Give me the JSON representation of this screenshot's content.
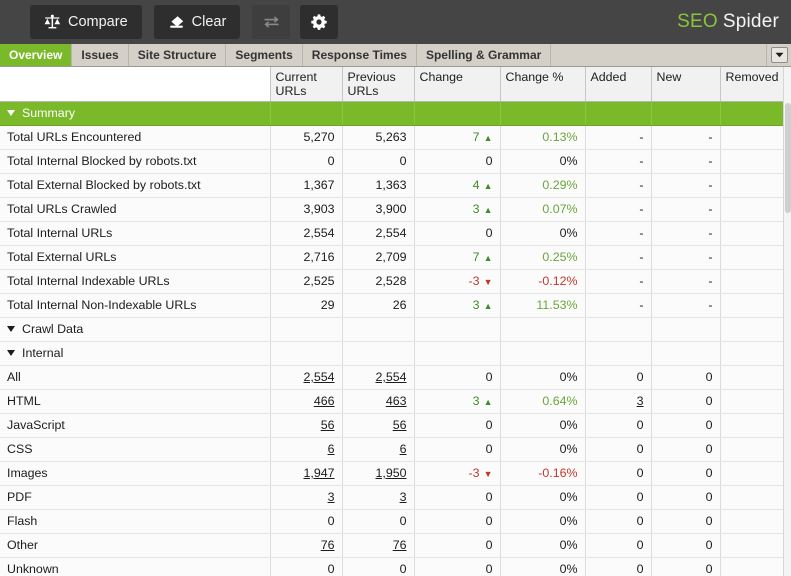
{
  "toolbar": {
    "compare_label": "Compare",
    "clear_label": "Clear",
    "swap_label": "",
    "settings_label": "",
    "logo_primary": "SEO",
    "logo_secondary": "Spider",
    "accent_color": "#7ab929",
    "bar_color": "#454545"
  },
  "tabs": [
    {
      "label": "Overview",
      "active": true
    },
    {
      "label": "Issues",
      "active": false
    },
    {
      "label": "Site Structure",
      "active": false
    },
    {
      "label": "Segments",
      "active": false
    },
    {
      "label": "Response Times",
      "active": false
    },
    {
      "label": "Spelling & Grammar",
      "active": false
    }
  ],
  "table": {
    "columns": [
      "",
      "Current URLs",
      "Previous URLs",
      "Change",
      "Change %",
      "Added",
      "New",
      "Removed"
    ],
    "rows": [
      {
        "type": "group",
        "indent": 0,
        "expanded": true,
        "name": "Summary",
        "current": "",
        "previous": "",
        "change": "",
        "change_pct": "",
        "added": "",
        "new": "",
        "removed": ""
      },
      {
        "type": "data",
        "indent": 1,
        "name": "Total URLs Encountered",
        "current": "5,270",
        "previous": "5,263",
        "change": "7",
        "change_dir": "up",
        "change_pct": "0.13%",
        "pct_dir": "pos",
        "added": "-",
        "new": "-",
        "removed": ""
      },
      {
        "type": "data",
        "indent": 1,
        "name": "Total Internal Blocked by robots.txt",
        "current": "0",
        "previous": "0",
        "change": "0",
        "change_dir": "none",
        "change_pct": "0%",
        "pct_dir": "none",
        "added": "-",
        "new": "-",
        "removed": ""
      },
      {
        "type": "data",
        "indent": 1,
        "name": "Total External Blocked by robots.txt",
        "current": "1,367",
        "previous": "1,363",
        "change": "4",
        "change_dir": "up",
        "change_pct": "0.29%",
        "pct_dir": "pos",
        "added": "-",
        "new": "-",
        "removed": ""
      },
      {
        "type": "data",
        "indent": 1,
        "name": "Total URLs Crawled",
        "current": "3,903",
        "previous": "3,900",
        "change": "3",
        "change_dir": "up",
        "change_pct": "0.07%",
        "pct_dir": "pos",
        "added": "-",
        "new": "-",
        "removed": ""
      },
      {
        "type": "data",
        "indent": 1,
        "name": "Total Internal URLs",
        "current": "2,554",
        "previous": "2,554",
        "change": "0",
        "change_dir": "none",
        "change_pct": "0%",
        "pct_dir": "none",
        "added": "-",
        "new": "-",
        "removed": ""
      },
      {
        "type": "data",
        "indent": 1,
        "name": "Total External URLs",
        "current": "2,716",
        "previous": "2,709",
        "change": "7",
        "change_dir": "up",
        "change_pct": "0.25%",
        "pct_dir": "pos",
        "added": "-",
        "new": "-",
        "removed": ""
      },
      {
        "type": "data",
        "indent": 1,
        "name": "Total Internal Indexable URLs",
        "current": "2,525",
        "previous": "2,528",
        "change": "-3",
        "change_dir": "down",
        "change_pct": "-0.12%",
        "pct_dir": "neg",
        "added": "-",
        "new": "-",
        "removed": ""
      },
      {
        "type": "data",
        "indent": 1,
        "name": "Total Internal Non-Indexable URLs",
        "current": "29",
        "previous": "26",
        "change": "3",
        "change_dir": "up",
        "change_pct": "11.53%",
        "pct_dir": "pos",
        "added": "-",
        "new": "-",
        "removed": ""
      },
      {
        "type": "section",
        "indent": 0,
        "expanded": true,
        "name": "Crawl Data",
        "current": "",
        "previous": "",
        "change": "",
        "change_pct": "",
        "added": "",
        "new": "",
        "removed": ""
      },
      {
        "type": "section",
        "indent": 1,
        "expanded": true,
        "name": "Internal",
        "current": "",
        "previous": "",
        "change": "",
        "change_pct": "",
        "added": "",
        "new": "",
        "removed": ""
      },
      {
        "type": "data",
        "indent": 2,
        "name": "All",
        "linked": true,
        "current": "2,554",
        "previous": "2,554",
        "change": "0",
        "change_dir": "none",
        "change_pct": "0%",
        "pct_dir": "none",
        "added": "0",
        "new": "0",
        "removed": ""
      },
      {
        "type": "data",
        "indent": 2,
        "name": "HTML",
        "linked": true,
        "current": "466",
        "previous": "463",
        "change": "3",
        "change_dir": "up",
        "change_pct": "0.64%",
        "pct_dir": "pos",
        "added": "3",
        "added_linked": true,
        "new": "0",
        "removed": ""
      },
      {
        "type": "data",
        "indent": 2,
        "name": "JavaScript",
        "linked": true,
        "current": "56",
        "previous": "56",
        "change": "0",
        "change_dir": "none",
        "change_pct": "0%",
        "pct_dir": "none",
        "added": "0",
        "new": "0",
        "removed": ""
      },
      {
        "type": "data",
        "indent": 2,
        "name": "CSS",
        "linked": true,
        "current": "6",
        "previous": "6",
        "change": "0",
        "change_dir": "none",
        "change_pct": "0%",
        "pct_dir": "none",
        "added": "0",
        "new": "0",
        "removed": ""
      },
      {
        "type": "data",
        "indent": 2,
        "name": "Images",
        "linked": true,
        "current": "1,947",
        "previous": "1,950",
        "change": "-3",
        "change_dir": "down",
        "change_pct": "-0.16%",
        "pct_dir": "neg",
        "added": "0",
        "new": "0",
        "removed": ""
      },
      {
        "type": "data",
        "indent": 2,
        "name": "PDF",
        "linked": true,
        "current": "3",
        "previous": "3",
        "change": "0",
        "change_dir": "none",
        "change_pct": "0%",
        "pct_dir": "none",
        "added": "0",
        "new": "0",
        "removed": ""
      },
      {
        "type": "data",
        "indent": 2,
        "name": "Flash",
        "linked": false,
        "current": "0",
        "previous": "0",
        "change": "0",
        "change_dir": "none",
        "change_pct": "0%",
        "pct_dir": "none",
        "added": "0",
        "new": "0",
        "removed": ""
      },
      {
        "type": "data",
        "indent": 2,
        "name": "Other",
        "linked": true,
        "current": "76",
        "previous": "76",
        "change": "0",
        "change_dir": "none",
        "change_pct": "0%",
        "pct_dir": "none",
        "added": "0",
        "new": "0",
        "removed": ""
      },
      {
        "type": "data",
        "indent": 2,
        "name": "Unknown",
        "linked": false,
        "current": "0",
        "previous": "0",
        "change": "0",
        "change_dir": "none",
        "change_pct": "0%",
        "pct_dir": "none",
        "added": "0",
        "new": "0",
        "removed": ""
      }
    ]
  }
}
